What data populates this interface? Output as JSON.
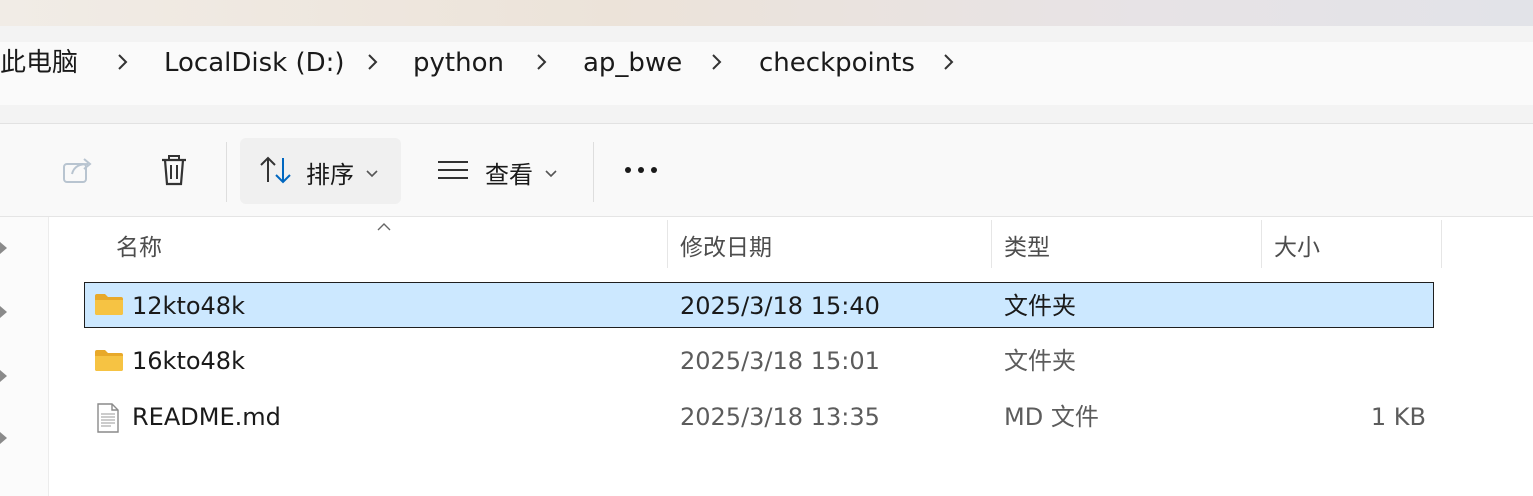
{
  "breadcrumb": [
    {
      "label": "此电脑"
    },
    {
      "label": "LocalDisk (D:)"
    },
    {
      "label": "python"
    },
    {
      "label": "ap_bwe"
    },
    {
      "label": "checkpoints"
    }
  ],
  "toolbar": {
    "sort_label": "排序",
    "view_label": "查看",
    "share_icon": "share-icon",
    "delete_icon": "trash-icon",
    "more_icon": "more-icon"
  },
  "columns": {
    "name": "名称",
    "modified": "修改日期",
    "type": "类型",
    "size": "大小"
  },
  "files": [
    {
      "name": "12kto48k",
      "modified": "2025/3/18 15:40",
      "type": "文件夹",
      "size": "",
      "icon": "folder-icon",
      "selected": true
    },
    {
      "name": "16kto48k",
      "modified": "2025/3/18 15:01",
      "type": "文件夹",
      "size": "",
      "icon": "folder-icon",
      "selected": false
    },
    {
      "name": "README.md",
      "modified": "2025/3/18 13:35",
      "type": "MD 文件",
      "size": "1 KB",
      "icon": "document-icon",
      "selected": false
    }
  ],
  "colors": {
    "selection": "#cce8ff",
    "accent": "#0067c0",
    "folder": "#f6c343"
  }
}
